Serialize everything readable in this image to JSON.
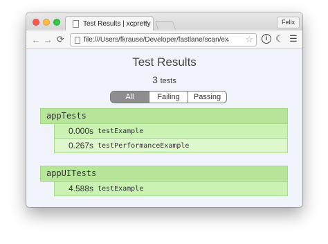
{
  "browser": {
    "tab_title": "Test Results | xcpretty",
    "tab_close": "×",
    "profile_name": "Felix",
    "url": "file:///Users/fkrause/Developer/fastlane/scan/exam...",
    "icons": {
      "back": "arrow-left-icon",
      "forward": "arrow-right-icon",
      "reload": "reload-icon",
      "star": "star-icon",
      "info": "info-icon",
      "moon": "moon-icon",
      "menu": "hamburger-menu-icon"
    }
  },
  "page": {
    "title": "Test Results",
    "count_number": "3",
    "count_unit": "tests",
    "filters": [
      "All",
      "Failing",
      "Passing"
    ],
    "active_filter": "All"
  },
  "suites": [
    {
      "name": "appTests",
      "tests": [
        {
          "time": "0.000s",
          "name": "testExample"
        },
        {
          "time": "0.267s",
          "name": "testPerformanceExample"
        }
      ]
    },
    {
      "name": "appUITests",
      "tests": [
        {
          "time": "4.588s",
          "name": "testExample"
        }
      ]
    }
  ],
  "colors": {
    "suite_header": "#b7e69a",
    "test_row": "#caf2b3",
    "active_filter": "#8e8e8e"
  }
}
